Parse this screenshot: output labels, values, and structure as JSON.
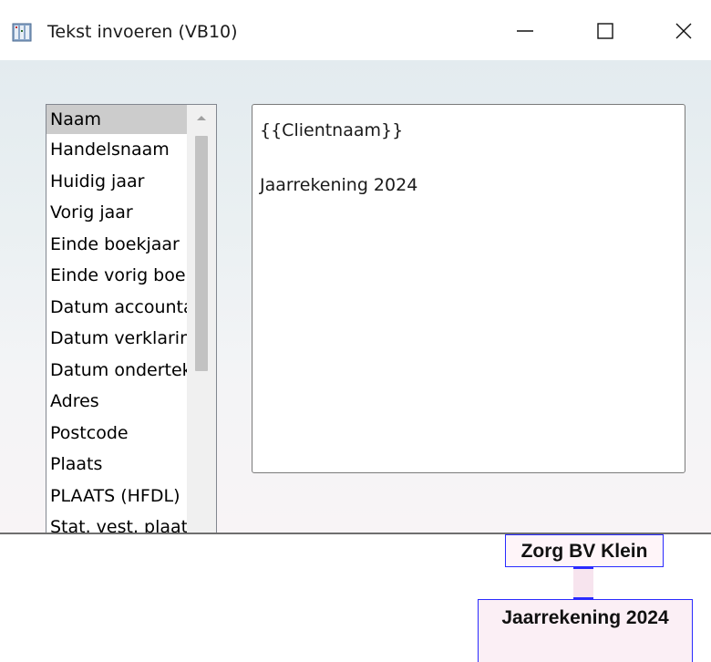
{
  "window": {
    "title": "Tekst invoeren (VB10)",
    "icon": "app-icon",
    "controls": {
      "minimize": "minimize-icon",
      "maximize": "maximize-icon",
      "close": "close-icon"
    }
  },
  "listbox": {
    "items": [
      "Naam",
      "Handelsnaam",
      "Huidig jaar",
      "Vorig jaar",
      "Einde boekjaar",
      "Einde vorig boekjaar",
      "Datum accountant",
      "Datum verklaring",
      "Datum ondertekening",
      "Adres",
      "Postcode",
      "Plaats",
      "PLAATS (HFDL)",
      "Stat. vest. plaats"
    ],
    "selected_index": 0,
    "scrollbar": {
      "up_icon": "chevron-up-icon"
    }
  },
  "textbox": {
    "lines": [
      "{{Clientnaam}}",
      "",
      "Jaarrekening 2024"
    ]
  },
  "document": {
    "box1_text": "Zorg BV Klein",
    "box2_text": "Jaarrekening 2024"
  },
  "colors": {
    "selection": "#cccccc",
    "doc_border": "#2a2aff",
    "client_gradient_top": "#e3ebef"
  }
}
